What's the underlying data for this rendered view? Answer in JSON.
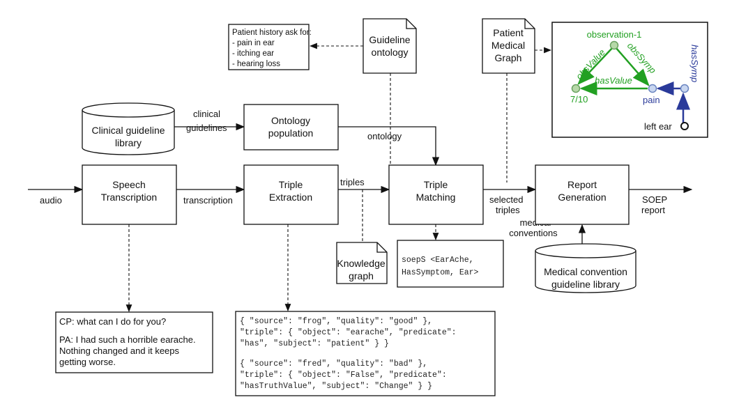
{
  "nodes": {
    "patient_history": [
      "Patient history ask for:",
      "- pain in ear",
      "- itching ear",
      "- hearing loss"
    ],
    "guideline_ontology": [
      "Guideline",
      "ontology"
    ],
    "patient_medical_graph": [
      "Patient",
      "Medical",
      "Graph"
    ],
    "clinical_library": [
      "Clinical guideline",
      "library"
    ],
    "ontology_population": [
      "Ontology",
      "population"
    ],
    "speech_transcription": [
      "Speech",
      "Transcription"
    ],
    "triple_extraction": [
      "Triple",
      "Extraction"
    ],
    "triple_matching": [
      "Triple",
      "Matching"
    ],
    "report_generation": [
      "Report",
      "Generation"
    ],
    "knowledge_graph": [
      "Knowledge",
      "graph"
    ],
    "soeps": [
      "soepS <EarAche,",
      "HasSymptom, Ear>"
    ],
    "medical_convention_library": [
      "Medical convention",
      "guideline library"
    ],
    "dialogue": [
      "CP: what can I do for you?",
      "PA: I had such a horrible earache.",
      "Nothing changed and it keeps",
      "getting worse."
    ],
    "json": [
      "{ \"source\": \"frog\", \"quality\": \"good\" },",
      "\"triple\": { \"object\": \"earache\", \"predicate\":",
      "\"has\", \"subject\": \"patient\" } }",
      "{ \"source\": \"fred\", \"quality\": \"bad\" },",
      "\"triple\": { \"object\": \"False\", \"predicate\":",
      "\"hasTruthValue\", \"subject\": \"Change\" } }"
    ]
  },
  "edges": {
    "audio": "audio",
    "transcription": "transcription",
    "triples": "triples",
    "selected_triples": [
      "selected",
      "triples"
    ],
    "soep_report": [
      "SOEP",
      "report"
    ],
    "clinical_guidelines": [
      "clinical",
      "guidelines"
    ],
    "ontology": "ontology",
    "medical_conventions": [
      "medical",
      "conventions"
    ]
  },
  "graph": {
    "observation": "observation-1",
    "obs_value": "obsValue",
    "obs_symp": "obsSymp",
    "has_value": "hasValue",
    "value": "7/10",
    "pain": "pain",
    "has_symp": "hasSymp",
    "left_ear": "left ear",
    "colors": {
      "green": "#22a022",
      "blue": "#2a3a9a"
    }
  }
}
